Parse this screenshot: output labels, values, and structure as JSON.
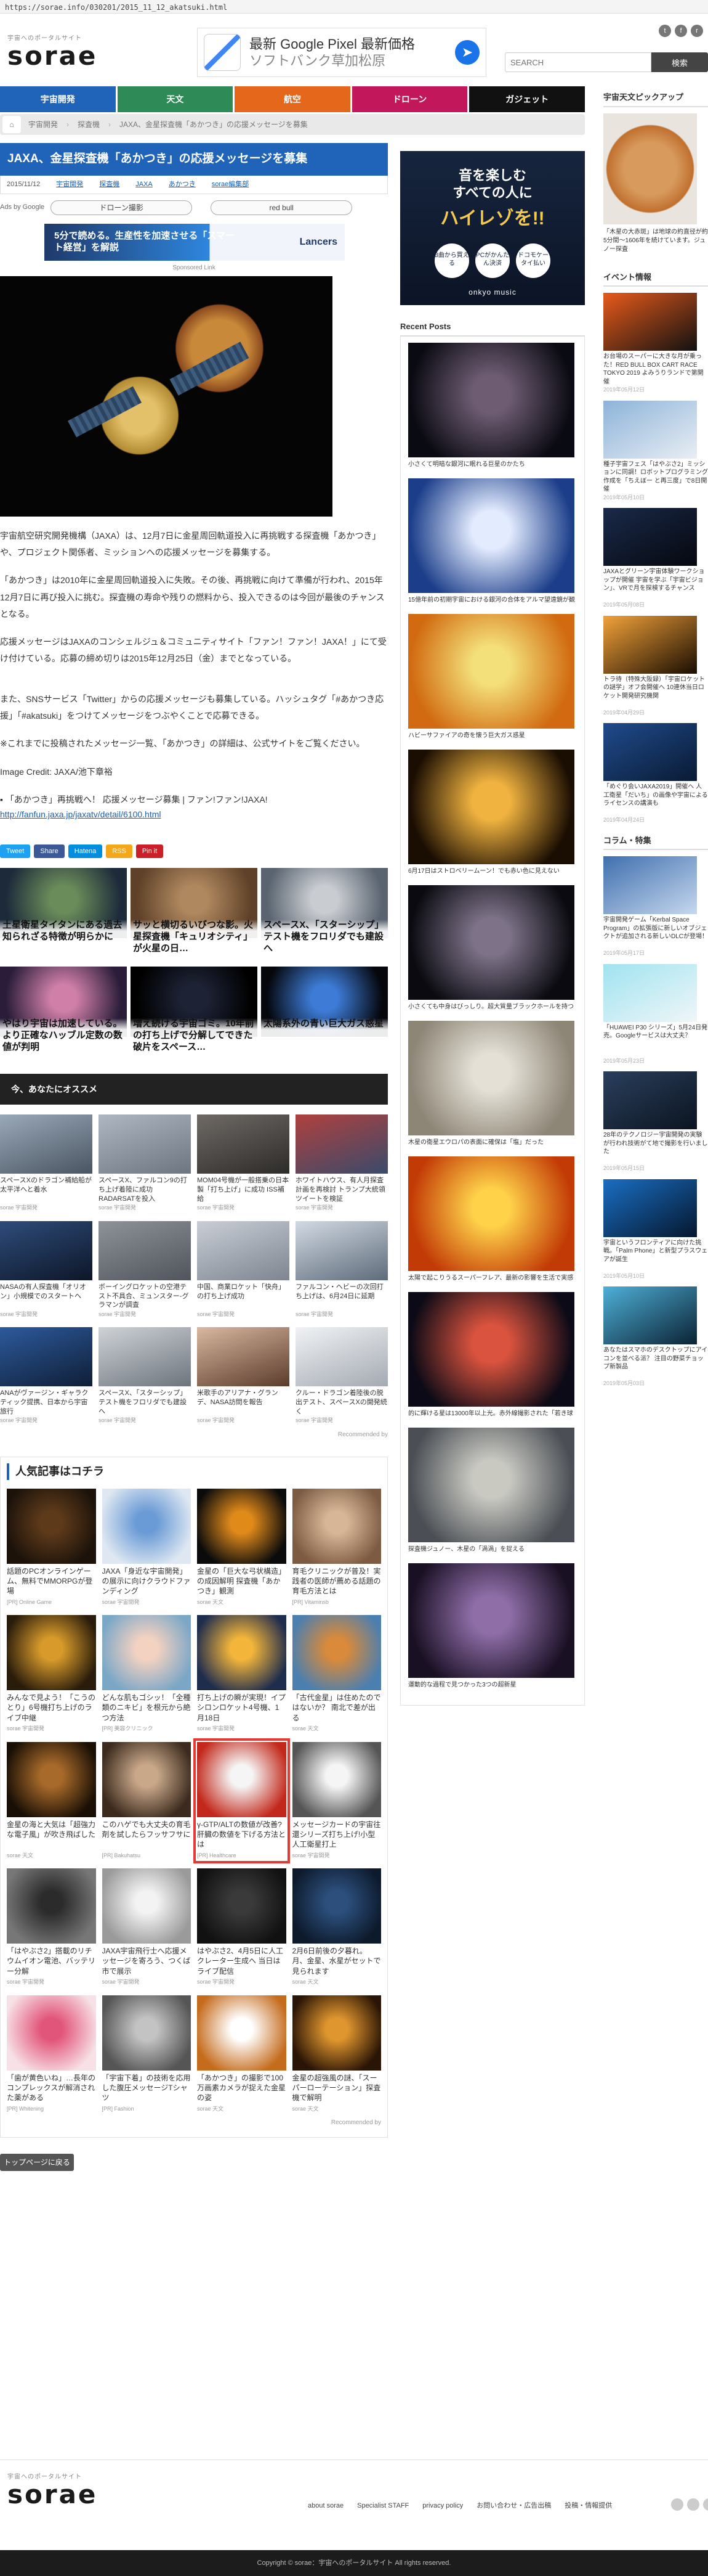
{
  "url": "https://sorae.info/030201/2015_11_12_akatsuki.html",
  "logo": {
    "tag": "宇宙へのポータルサイト",
    "name": "sorae"
  },
  "top_ad": {
    "line1": "最新 Google Pixel 最新価格",
    "line2": "ソフトバンク草加松原",
    "icon": "directions-icon"
  },
  "search": {
    "placeholder": "SEARCH",
    "button": "検索"
  },
  "nav": [
    {
      "label": "宇宙開発",
      "color": "#1f64b8"
    },
    {
      "label": "天文",
      "color": "#2e8b57"
    },
    {
      "label": "航空",
      "color": "#e5671b"
    },
    {
      "label": "ドローン",
      "color": "#c2185b"
    },
    {
      "label": "ガジェット",
      "color": "#111111"
    }
  ],
  "breadcrumb": [
    "宇宙開発",
    "探査機",
    "JAXA、金星探査機「あかつき」の応援メッセージを募集"
  ],
  "article": {
    "title": "JAXA、金星探査機「あかつき」の応援メッセージを募集",
    "date": "2015/11/12",
    "tags": [
      "宇宙開発",
      "探査機",
      "JAXA",
      "あかつき",
      "sorae編集部"
    ],
    "ads_by": "Ads by Google",
    "ad_pills": [
      "ドローン撮影",
      "red bull"
    ],
    "banner": {
      "text": "5分で読める。生産性を加速させる「スマート経営」を解説",
      "brand": "Lancers"
    },
    "sponsored": "Sponsored Link",
    "p1": "宇宙航空研究開発機構（JAXA）は、12月7日に金星周回軌道投入に再挑戦する探査機「あかつき」や、プロジェクト関係者、ミッションへの応援メッセージを募集する。",
    "p2": "「あかつき」は2010年に金星周回軌道投入に失敗。その後、再挑戦に向けて準備が行われ、2015年12月7日に再び投入に挑む。探査機の寿命や残りの燃料から、投入できるのは今回が最後のチャンスとなる。",
    "p3": "応援メッセージはJAXAのコンシェルジュ＆コミュニティサイト「ファン！ファン！JAXA！」にて受け付けている。応募の締め切りは2015年12月25日（金）までとなっている。",
    "p4": "また、SNSサービス「Twitter」からの応援メッセージも募集している。ハッシュタグ「#あかつき応援」「#akatsuki」をつけてメッセージをつぶやくことで応募できる。",
    "p5": "※これまでに投稿されたメッセージ一覧、「あかつき」の詳細は、公式サイトをご覧ください。",
    "credit": "Image Credit: JAXA/池下章裕",
    "link_label": "「あかつき」再挑戦へ！ 応援メッセージ募集 | ファン!ファン!JAXA!",
    "link_url": "http://fanfun.jaxa.jp/jaxatv/detail/6100.html",
    "share": [
      {
        "label": "Tweet",
        "color": "#1da1f2"
      },
      {
        "label": "Share",
        "color": "#3b5998"
      },
      {
        "label": "Hatena",
        "color": "#008fde"
      },
      {
        "label": "RSS",
        "color": "#f3a71b"
      },
      {
        "label": "Pin it",
        "color": "#cb2027"
      }
    ]
  },
  "related": [
    {
      "title": "土星衛星タイタンにある過去知られざる特徴が明らかに",
      "c1": "#6a8c5a",
      "c2": "#1d2a3a"
    },
    {
      "title": "サッと横切るいびつな影。火星探査機「キュリオシティ」が火星の日…",
      "c1": "#b08860",
      "c2": "#5e4128"
    },
    {
      "title": "スペースX、「スターシップ」テスト機をフロリダでも建設へ",
      "c1": "#c9ccd1",
      "c2": "#5a6470"
    },
    {
      "title": "やはり宇宙は加速している。より正確なハッブル定数の数値が判明",
      "c1": "#cf7fa8",
      "c2": "#2b1d3a"
    },
    {
      "title": "増え続ける宇宙ゴミ。10年前の打ち上げで分解してできた破片をスペース…",
      "c1": "#1d2235",
      "c2": "#000000"
    },
    {
      "title": "太陽系外の青い巨大ガス惑星",
      "c1": "#3d7bd6",
      "c2": "#05070d"
    }
  ],
  "osusume": {
    "heading": "今、あなたにオススメ",
    "items": [
      {
        "title": "スペースXのドラゴン補給船が太平洋へと着水",
        "src": "sorae 宇宙開発",
        "c1": "#9aa9b8",
        "c2": "#4a5563"
      },
      {
        "title": "スペースX、ファルコン9の打ち上げ着陸に成功 RADARSATを投入",
        "src": "sorae 宇宙開発",
        "c1": "#aeb7c2",
        "c2": "#6c7580"
      },
      {
        "title": "MOM04号機が一般搭乗の日本製「打ち上げ」に成功 ISS補給",
        "src": "sorae 宇宙開発",
        "c1": "#6f6a66",
        "c2": "#2d2b29"
      },
      {
        "title": "ホワイトハウス、有人月探査計画を再検討 トランプ大統領ツイートを検証",
        "src": "sorae 宇宙開発",
        "c1": "#b0413e",
        "c2": "#3a4a6b"
      },
      {
        "title": "NASAの有人探査機「オリオン」小規模でのスタートへ",
        "src": "sorae 宇宙開発",
        "c1": "#2e4c7a",
        "c2": "#0d1628"
      },
      {
        "title": "ボーイングロケットの空港テスト不具合、ミュンスター-グラマンが調査",
        "src": "sorae 宇宙開発",
        "c1": "#8e9299",
        "c2": "#50545b"
      },
      {
        "title": "中国、商業ロケット「快舟」の打ち上げ成功",
        "src": "sorae 宇宙開発",
        "c1": "#c9ced6",
        "c2": "#7e8590"
      },
      {
        "title": "ファルコン・ヘビーの次回打ち上げは、6月24日に延期",
        "src": "sorae 宇宙開発",
        "c1": "#d2dae4",
        "c2": "#5e6b7a"
      },
      {
        "title": "ANAがヴァージン・ギャラクティック提携、日本から宇宙旅行",
        "src": "sorae 宇宙開発",
        "c1": "#2d5a9c",
        "c2": "#0f1e36"
      },
      {
        "title": "スペースX、「スターシップ」テスト機をフロリダでも建設へ",
        "src": "sorae 宇宙開発",
        "c1": "#cfd3d8",
        "c2": "#6d747c"
      },
      {
        "title": "米歌手のアリアナ・グランデ、NASA訪問を報告",
        "src": "sorae 宇宙開発",
        "c1": "#d9b8a0",
        "c2": "#5b3b2b"
      },
      {
        "title": "クルー・ドラゴン着陸後の脱出テスト、スペースXの開発続く",
        "src": "sorae 宇宙開発",
        "c1": "#f0f2f5",
        "c2": "#a4aab2"
      }
    ],
    "recommended": "Recommended by"
  },
  "popular": {
    "heading": "人気記事はコチラ",
    "items": [
      {
        "title": "話題のPCオンラインゲーム、無料でMMORPGが登場",
        "src": "[PR] Online Game",
        "c1": "#5d3a1a",
        "c2": "#1c120a",
        "hl": false
      },
      {
        "title": "JAXA「身近な宇宙開発」の展示に向けクラウドファンディング",
        "src": "sorae 宇宙開発",
        "c1": "#6b9bd6",
        "c2": "#dfe8f2",
        "hl": false
      },
      {
        "title": "金星の「巨大な弓状構造」の成因解明 探査機「あかつき」観測",
        "src": "sorae 天文",
        "c1": "#e08a1a",
        "c2": "#0b0b0b",
        "hl": false
      },
      {
        "title": "育毛クリニックが普及！実践者の医師が薦める話題の育毛方法とは",
        "src": "[PR] Vitaminsb",
        "c1": "#d7b697",
        "c2": "#7d5b42",
        "hl": false
      },
      {
        "title": "みんなで見よう！「こうのとり」6号機打ち上げのライブ中継",
        "src": "sorae 宇宙開発",
        "c1": "#d89b2b",
        "c2": "#2a1c0b",
        "hl": false
      },
      {
        "title": "どんな肌もゴシッ！「全種類のニキビ」を根元から絶つ方法",
        "src": "[PR] 美容クリニック",
        "c1": "#f4d2c1",
        "c2": "#7ba7c7",
        "hl": false
      },
      {
        "title": "打ち上げの瞬が実現！イプシロンロケット4号機、1月18日",
        "src": "sorae 宇宙開発",
        "c1": "#f4b63a",
        "c2": "#1f2d4d",
        "hl": false
      },
      {
        "title": "「古代金星」は住めたのではないか？ 南北で差が出る",
        "src": "sorae 天文",
        "c1": "#d98a3a",
        "c2": "#4a7fb0",
        "hl": false
      },
      {
        "title": "金星の海と大気は「超強力な電子風」が吹き飛ばした",
        "src": "sorae 天文",
        "c1": "#a86a2a",
        "c2": "#1a0f05",
        "hl": false
      },
      {
        "title": "このハゲでも大丈夫の育毛剤を試したらフッサフサに",
        "src": "[PR] Bakuhatsu",
        "c1": "#c9a88a",
        "c2": "#3b2a1d",
        "hl": false
      },
      {
        "title": "γ-GTP/ALTの数値が改善?肝臓の数値を下げる方法とは",
        "src": "[PR] Healthcare",
        "c1": "#f5f5f5",
        "c2": "#c2281b",
        "hl": true
      },
      {
        "title": "メッセージカードの宇宙往還シリーズ打ち上げ!小型人工衛星打上",
        "src": "sorae 宇宙開発",
        "c1": "#f5f5f5",
        "c2": "#555555",
        "hl": false
      },
      {
        "title": "「はやぶさ2」搭載のリチウムイオン電池、バッテリー分解",
        "src": "sorae 宇宙開発",
        "c1": "#2b2b2b",
        "c2": "#777777",
        "hl": false
      },
      {
        "title": "JAXA宇宙飛行士へ応援メッセージを寄ろう、つくば市で展示",
        "src": "sorae 宇宙開発",
        "c1": "#f3f3f3",
        "c2": "#9a9a9a",
        "hl": false
      },
      {
        "title": "はやぶさ2、4月5日に人工クレーター生成へ 当日はライブ配信",
        "src": "sorae 宇宙開発",
        "c1": "#3a3a3a",
        "c2": "#111111",
        "hl": false
      },
      {
        "title": "2月6日前後の夕暮れ。月、金星、水星がセットで見られます",
        "src": "sorae 天文",
        "c1": "#2c4f7c",
        "c2": "#0d1a2c",
        "hl": false
      },
      {
        "title": "「歯が黄色いね」…長年のコンプレックスが解消された薬がある",
        "src": "[PR] Whitening",
        "c1": "#e2557a",
        "c2": "#f7e1e6",
        "hl": false
      },
      {
        "title": "「宇宙下着」の技術を応用した腹圧メッセージTシャツ",
        "src": "[PR] Fashion",
        "c1": "#c3c3c3",
        "c2": "#555555",
        "hl": false
      },
      {
        "title": "「あかつき」の撮影で100万画素カメラが捉えた金星の姿",
        "src": "sorae 天文",
        "c1": "#ffffff",
        "c2": "#c56b1c",
        "hl": false
      },
      {
        "title": "金星の超強風の謎、「スーパーローテーション」探査機で解明",
        "src": "sorae 天文",
        "c1": "#e0962e",
        "c2": "#2a1405",
        "hl": false
      }
    ],
    "recommended": "Recommended by"
  },
  "top_back": "トップページに戻る",
  "mid_ad": {
    "line1": "音を楽しむ",
    "line2": "すべての人に",
    "line3": "ハイレゾを!!",
    "circles": [
      "3曲から買える",
      "PCがかんたん決済",
      "ドコモケータイ払い"
    ],
    "brand": "onkyo music"
  },
  "recent": {
    "heading": "Recent Posts",
    "items": [
      {
        "title": "小さくて明暗な銀河に眠れる巨星のかたち",
        "c1": "#6e5c73",
        "c2": "#0a0a12"
      },
      {
        "title": "15億年前の初期宇宙における銀河の合体をアルマ望遠鏡が観測",
        "c1": "#e3ecff",
        "c2": "#1c3e8a"
      },
      {
        "title": "ハビーサファイアの奇を懐う巨大ガス惑星",
        "c1": "#f4e07a",
        "c2": "#d16a10"
      },
      {
        "title": "6月17日はストロベリームーン！でも赤い色に見えない",
        "c1": "#f1b340",
        "c2": "#1a0d02"
      },
      {
        "title": "小さくても中身はびっしり。超大質量ブラックホールを持つ巨大銀河",
        "c1": "#7d7288",
        "c2": "#0a0a10"
      },
      {
        "title": "木星の衛星エウロパの表面に確保は「塩」だった",
        "c1": "#e4e0d6",
        "c2": "#8d8576"
      },
      {
        "title": "太陽で起こりうるスーパーフレア、最新の影響を生活で実感が「いつ」起こるのか",
        "c1": "#ffd24a",
        "c2": "#c23a05"
      },
      {
        "title": "的に輝ける星は13000年以上光。赤外線撮影された「若き球体」",
        "c1": "#d9533e",
        "c2": "#0c0a16"
      },
      {
        "title": "探査機ジュノー、木星の「渦渦」を捉える",
        "c1": "#c9c9c2",
        "c2": "#4b4f55"
      },
      {
        "title": "運動的な過程で見つかった3つの超新星",
        "c1": "#8f6ea8",
        "c2": "#1a1024"
      }
    ]
  },
  "right_side": {
    "pickup_heading": "宇宙天文ピックアップ",
    "pickup_text": "「木星の大赤斑」は地球の約直径が約5分間〜1606年を続けています。ジュノー探査",
    "event_heading": "イベント情報",
    "events": [
      {
        "title": "お台場のスーパーに大きな月が乗った！RED BULL BOX CART RACE TOKYO 2019 よみうりランドで第開催",
        "date": "2019年05月12日",
        "c1": "#e85a1b",
        "c2": "#111"
      },
      {
        "title": "種子宇宙フェス「はやぶさ2」ミッションに同調！ロボットプログラミング作成を「ちえぼー と再三度」で8日開催",
        "date": "2019年05月10日",
        "c1": "#8db3d9",
        "c2": "#e9eef4"
      },
      {
        "title": "JAXAとグリーン宇宙体験ワークショップが開催 宇宙を学ぶ「宇宙ビジョン」、VRで月を探検するチャンス",
        "date": "2019年05月08日",
        "c1": "#1a2a4a",
        "c2": "#05070d"
      },
      {
        "title": "トラ待（特殊大阪録）「宇宙ロケットの謎学」オフ会開催へ 10連休当日ロケット開発研究機関",
        "date": "2019年04月29日",
        "c1": "#f2a23a",
        "c2": "#1a0d02"
      },
      {
        "title": "「めぐり会いJAXA2019」開催へ 人工衛星「だいち」の画像や宇宙によるライセンスの講演も",
        "date": "2019年04月24日",
        "c1": "#1f4b8c",
        "c2": "#0a1a33"
      }
    ],
    "column_heading": "コラム・特集",
    "columns": [
      {
        "title": "宇宙開発ゲーム「Kerbal Space Program」の拡張版に新しいオブジェクトが追加される新しいDLCが登場！",
        "date": "2019年05月17日",
        "c1": "#3f6fae",
        "c2": "#c6d8ee"
      },
      {
        "title": "「HUAWEI P30 シリーズ」5月24日発売。Googleサービスは大丈夫？",
        "date": "2019年05月23日",
        "c1": "#9fe3f0",
        "c2": "#f0f6f8"
      },
      {
        "title": "28年のテクノロジー宇宙開発の実験が行われ技術がて地で撮影を行いました",
        "date": "2019年05月15日",
        "c1": "#2a3f5c",
        "c2": "#0b1420"
      },
      {
        "title": "宇宙というフロンティアに向けた挑戦。「Palm Phone」と新型プラスウェアが誕生",
        "date": "2019年05月10日",
        "c1": "#1a6ec2",
        "c2": "#05172e"
      },
      {
        "title": "あなたはスマホのデスクトップにアイコンを並べる派？ 注目の野菜チョップ新製品",
        "date": "2019年05月03日",
        "c1": "#4eb0d8",
        "c2": "#0b2233"
      }
    ]
  },
  "footer": {
    "links": [
      "about sorae",
      "Specialist STAFF",
      "privacy policy",
      "お問い合わせ・広告出稿",
      "投稿・情報提供"
    ],
    "copyright": "Copyright © sorae：宇宙へのポータルサイト All rights reserved."
  }
}
